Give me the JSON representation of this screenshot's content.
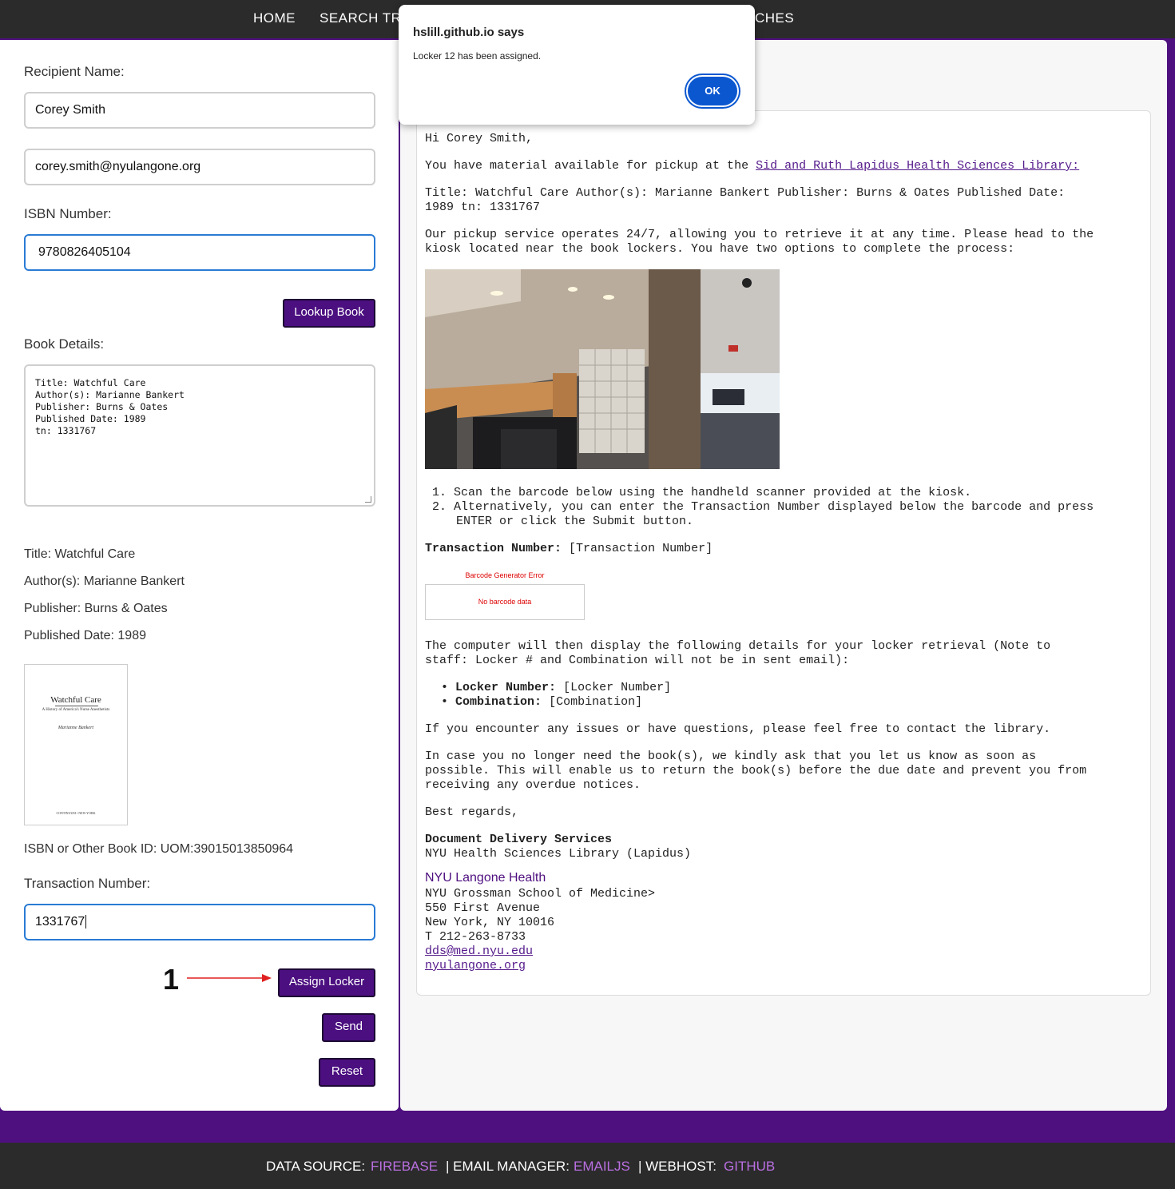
{
  "nav": {
    "home": "HOME",
    "search": "SEARCH TR",
    "searches": "CHES"
  },
  "form": {
    "recipient_label": "Recipient Name:",
    "recipient_value": "Corey Smith",
    "email_value": "corey.smith@nyulangone.org",
    "isbn_label": "ISBN Number:",
    "isbn_value": "9780826405104",
    "lookup_button": "Lookup Book",
    "book_details_label": "Book Details:",
    "book_details_text": "Title: Watchful Care\nAuthor(s): Marianne Bankert\nPublisher: Burns & Oates\nPublished Date: 1989\ntn: 1331767",
    "transaction_label": "Transaction Number:",
    "transaction_value": "1331767",
    "assign_button": "Assign Locker",
    "send_button": "Send",
    "reset_button": "Reset"
  },
  "book": {
    "title": "Title: Watchful Care",
    "authors": "Author(s): Marianne Bankert",
    "publisher": "Publisher: Burns & Oates",
    "published": "Published Date: 1989",
    "id": "ISBN or Other Book ID: UOM:39015013850964",
    "cover": {
      "title": "Watchful Care",
      "subtitle": "A History of America's Nurse Anesthetists",
      "author": "Marianne Bankert",
      "publisher": "CONTINUUM • NEW YORK"
    }
  },
  "annotation": {
    "number": "1"
  },
  "email": {
    "greeting": "Hi Corey Smith,",
    "intro_prefix": "You have material available for pickup at the ",
    "intro_link": "Sid and Ruth Lapidus Health Sciences Library:",
    "book_line1": "Title: Watchful Care Author(s): Marianne Bankert Publisher: Burns & Oates Published Date:",
    "book_line2": "1989 tn: 1331767",
    "service_line1": "Our pickup service operates 24/7, allowing you to retrieve it at any time. Please head to the",
    "service_line2": "kiosk located near the book lockers. You have two options to complete the process:",
    "step1": "Scan the barcode below using the handheld scanner provided at the kiosk.",
    "step2_line1": "Alternatively, you can enter the Transaction Number displayed below the barcode and press",
    "step2_line2": "ENTER or click the Submit button.",
    "transaction_label": "Transaction Number:",
    "transaction_value": "[Transaction Number]",
    "barcode_title": "Barcode Generator Error",
    "barcode_error": "No barcode data",
    "computer_line1": "The computer will then display the following details for your locker retrieval (Note to",
    "computer_line2": "staff: Locker # and Combination will not be in sent email):",
    "locker_label": "Locker Number:",
    "locker_value": "[Locker Number]",
    "combo_label": "Combination:",
    "combo_value": "[Combination]",
    "issues": "If you encounter any issues or have questions, please feel free to contact the library.",
    "case_line1": "In case you no longer need the book(s), we kindly ask that you let us know as soon as",
    "case_line2": "possible. This will enable us to return the book(s) before the due date and prevent you from",
    "case_line3": "receiving any overdue notices.",
    "regards": "Best regards,",
    "sig_dept": "Document Delivery Services",
    "sig_library": "NYU Health Sciences Library (Lapidus)",
    "sig_brand": "NYU Langone Health",
    "sig_school": "NYU Grossman School of Medicine>",
    "sig_address": "550 First Avenue",
    "sig_city": "New York, NY 10016",
    "sig_phone": "T 212-263-8733",
    "sig_email": "dds@med.nyu.edu",
    "sig_web": "nyulangone.org"
  },
  "dialog": {
    "title": "hslill.github.io says",
    "message": "Locker 12 has been assigned.",
    "ok": "OK"
  },
  "footer": {
    "data_source_label": "DATA SOURCE:",
    "data_source_value": "FIREBASE",
    "email_manager_label": "| EMAIL MANAGER:",
    "email_manager_value": "EMAILJS",
    "webhost_label": "| WEBHOST:",
    "webhost_value": "GITHUB"
  },
  "colors": {
    "brand_purple": "#4b0f80",
    "focus_blue": "#2a7bd4",
    "dialog_ok": "#0b57d0",
    "footer_link": "#b96fe0"
  }
}
